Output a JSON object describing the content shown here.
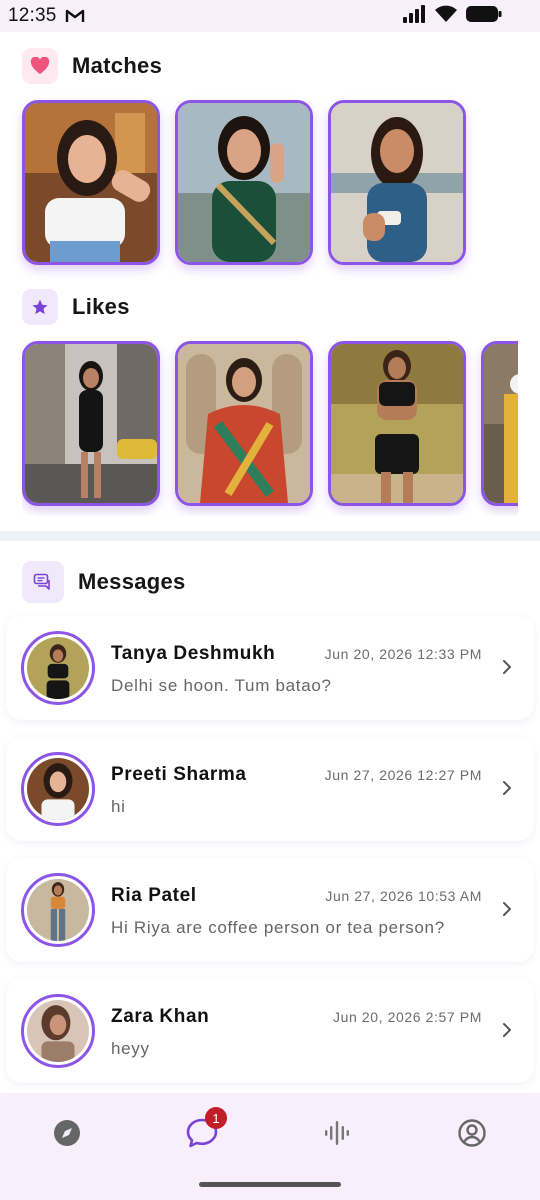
{
  "status_bar": {
    "time": "12:35"
  },
  "sections": {
    "matches": {
      "title": "Matches",
      "icon": "heart-icon"
    },
    "likes": {
      "title": "Likes",
      "icon": "star-icon"
    },
    "messages": {
      "title": "Messages",
      "icon": "chat-bubbles-icon"
    }
  },
  "matches": [
    {
      "id": "match-1",
      "photo": "woman in white top"
    },
    {
      "id": "match-2",
      "photo": "woman in green saree"
    },
    {
      "id": "match-3",
      "photo": "woman in blue top holding cup"
    }
  ],
  "likes": [
    {
      "id": "like-1",
      "photo": "woman in black dress on city street"
    },
    {
      "id": "like-2",
      "photo": "woman in colorful dupatta"
    },
    {
      "id": "like-3",
      "photo": "woman in black sports outfit"
    },
    {
      "id": "like-4",
      "photo": "partially visible profile"
    }
  ],
  "messages": [
    {
      "name": "Tanya Deshmukh",
      "time": "Jun 20, 2026 12:33 PM",
      "text": "Delhi se hoon. Tum batao?"
    },
    {
      "name": "Preeti Sharma",
      "time": "Jun 27, 2026 12:27 PM",
      "text": "hi"
    },
    {
      "name": "Ria Patel",
      "time": "Jun 27, 2026 10:53 AM",
      "text": "Hi Riya are coffee person or tea person?"
    },
    {
      "name": "Zara Khan",
      "time": "Jun 20, 2026 2:57 PM",
      "text": "heyy"
    }
  ],
  "bottom_nav": {
    "items": [
      {
        "name": "explore",
        "icon": "compass-icon",
        "active": false
      },
      {
        "name": "chats",
        "icon": "chat-icon",
        "active": true,
        "badge": "1"
      },
      {
        "name": "voice",
        "icon": "soundwave-icon",
        "active": false
      },
      {
        "name": "profile",
        "icon": "profile-icon",
        "active": false
      }
    ]
  },
  "colors": {
    "accent": "#8c55e6",
    "heart": "#f0537d",
    "badge": "#c21e2a",
    "nav_background": "#f9eefb"
  }
}
